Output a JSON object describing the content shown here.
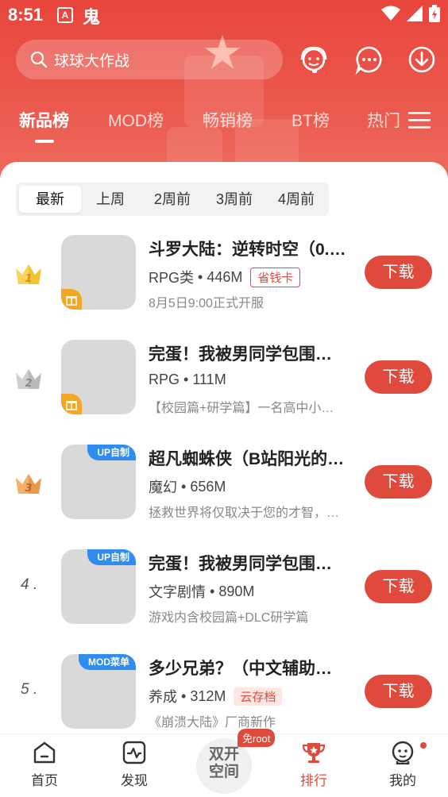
{
  "status_bar": {
    "time": "8:51",
    "a_badge": "A",
    "ghost": "鬼"
  },
  "search": {
    "placeholder": "球球大作战"
  },
  "header_icons": [
    "support-icon",
    "message-icon",
    "download-icon"
  ],
  "tabs": [
    {
      "label": "新品榜",
      "active": true
    },
    {
      "label": "MOD榜"
    },
    {
      "label": "畅销榜"
    },
    {
      "label": "BT榜"
    },
    {
      "label": "热门"
    }
  ],
  "periods": [
    {
      "label": "最新",
      "active": true
    },
    {
      "label": "上周"
    },
    {
      "label": "2周前"
    },
    {
      "label": "3周前"
    },
    {
      "label": "4周前"
    }
  ],
  "games": [
    {
      "rank": "1",
      "rank_style": "gold",
      "title": "斗罗大陆：逆转时空（0.…",
      "category": "RPG类",
      "size": "446M",
      "chip": "省钱卡",
      "chip_style": "red-border",
      "desc": "8月5日9:00正式开服",
      "badge": "gift",
      "button": "下载"
    },
    {
      "rank": "2",
      "rank_style": "silver",
      "title": "完蛋！我被男同学包围…",
      "category": "RPG",
      "size": "111M",
      "chip": "",
      "desc": "【校园篇+研学篇】一名高中小…",
      "badge": "gift",
      "button": "下载"
    },
    {
      "rank": "3",
      "rank_style": "bronze",
      "title": "超凡蜘蛛侠（B站阳光的…",
      "category": "魔幻",
      "size": "656M",
      "chip": "",
      "desc": "拯救世界将仅取决于您的才智，…",
      "badge": "UP自制",
      "button": "下载"
    },
    {
      "rank": "4 .",
      "rank_style": "plain",
      "title": "完蛋！我被男同学包围…",
      "category": "文字剧情",
      "size": "890M",
      "chip": "",
      "desc": "游戏内含校园篇+DLC研学篇",
      "badge": "UP自制",
      "button": "下载"
    },
    {
      "rank": "5 .",
      "rank_style": "plain",
      "title": "多少兄弟？（中文辅助…",
      "category": "养成",
      "size": "312M",
      "chip": "云存档",
      "chip_style": "red-fill",
      "desc": "《崩溃大陆》厂商新作",
      "badge": "MOD菜单",
      "button": "下载"
    }
  ],
  "bottom_nav": [
    {
      "label": "首页",
      "icon": "home-icon"
    },
    {
      "label": "发现",
      "icon": "discover-icon"
    },
    {
      "label": "双开空间",
      "icon": "dual-space"
    },
    {
      "label": "排行",
      "icon": "trophy-icon",
      "active": true
    },
    {
      "label": "我的",
      "icon": "profile-icon"
    }
  ],
  "center_badge": "免root",
  "center_text_line1": "双开",
  "center_text_line2": "空间",
  "colors": {
    "accent": "#e04a3c",
    "header": "#e8453c",
    "tag_blue": "#2f8cf0",
    "gift": "#f5a623"
  }
}
